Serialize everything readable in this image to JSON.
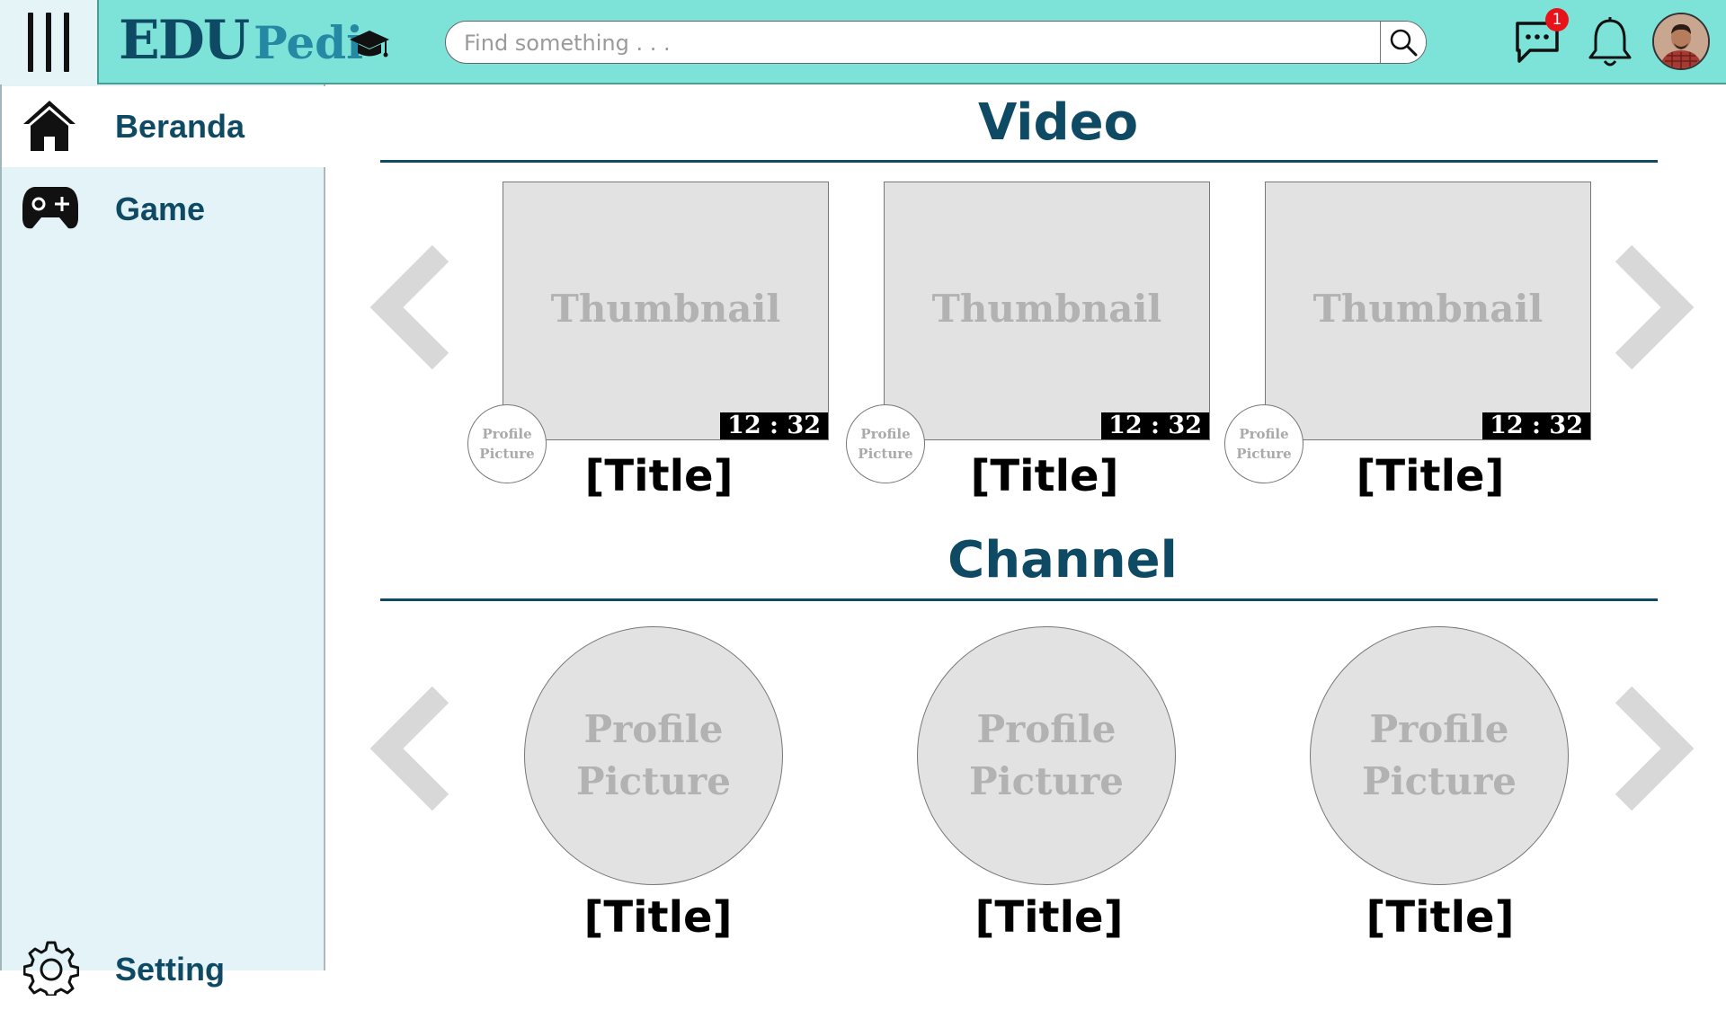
{
  "app": {
    "logo_primary": "EDU",
    "logo_secondary": "Pedi"
  },
  "header": {
    "search_placeholder": "Find something . . .",
    "message_badge": "1"
  },
  "sidebar": {
    "items": [
      {
        "label": "Beranda",
        "icon": "home-icon",
        "active": true
      },
      {
        "label": "Game",
        "icon": "gamepad-icon",
        "active": false
      }
    ],
    "setting_label": "Setting"
  },
  "video_section": {
    "heading": "Video",
    "videos": [
      {
        "thumbnail_label": "Thumbnail",
        "duration": "12 : 32",
        "profile_line1": "Profile",
        "profile_line2": "Picture",
        "title": "[Title]"
      },
      {
        "thumbnail_label": "Thumbnail",
        "duration": "12 : 32",
        "profile_line1": "Profile",
        "profile_line2": "Picture",
        "title": "[Title]"
      },
      {
        "thumbnail_label": "Thumbnail",
        "duration": "12 : 32",
        "profile_line1": "Profile",
        "profile_line2": "Picture",
        "title": "[Title]"
      }
    ]
  },
  "channel_section": {
    "heading": "Channel",
    "channels": [
      {
        "picture_line1": "Profile",
        "picture_line2": "Picture",
        "title": "[Title]"
      },
      {
        "picture_line1": "Profile",
        "picture_line2": "Picture",
        "title": "[Title]"
      },
      {
        "picture_line1": "Profile",
        "picture_line2": "Picture",
        "title": "[Title]"
      }
    ]
  },
  "colors": {
    "header_bg": "#7de3d8",
    "sidebar_bg": "#e3f3f7",
    "brand_dark": "#0e4a63",
    "badge_red": "#e8121b",
    "placeholder_gray": "#e2e2e2"
  }
}
